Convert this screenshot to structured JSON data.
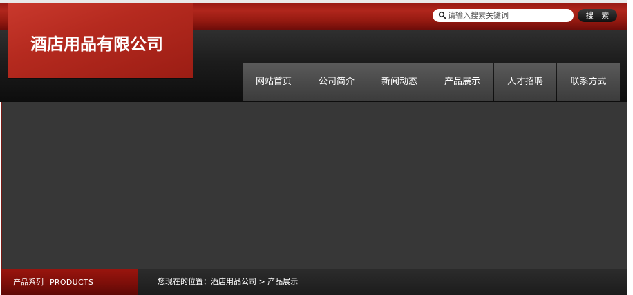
{
  "header": {
    "company_name": "酒店用品有限公司",
    "search": {
      "placeholder": "请输入搜索关键词",
      "button_label": "搜 索"
    }
  },
  "nav": {
    "items": [
      {
        "label": "网站首页"
      },
      {
        "label": "公司简介"
      },
      {
        "label": "新闻动态"
      },
      {
        "label": "产品展示"
      },
      {
        "label": "人才招聘"
      },
      {
        "label": "联系方式"
      }
    ]
  },
  "sidebar": {
    "title_cn": "产品系列",
    "title_en": "PRODUCTS"
  },
  "breadcrumb": {
    "text": "您现在的位置：酒店用品公司 > 产品展示"
  },
  "colors": {
    "brand_red": "#b52a1f",
    "dark_bg": "#373737",
    "nav_bg": "#4a4a4a"
  },
  "icons": {
    "search": "search-icon"
  }
}
